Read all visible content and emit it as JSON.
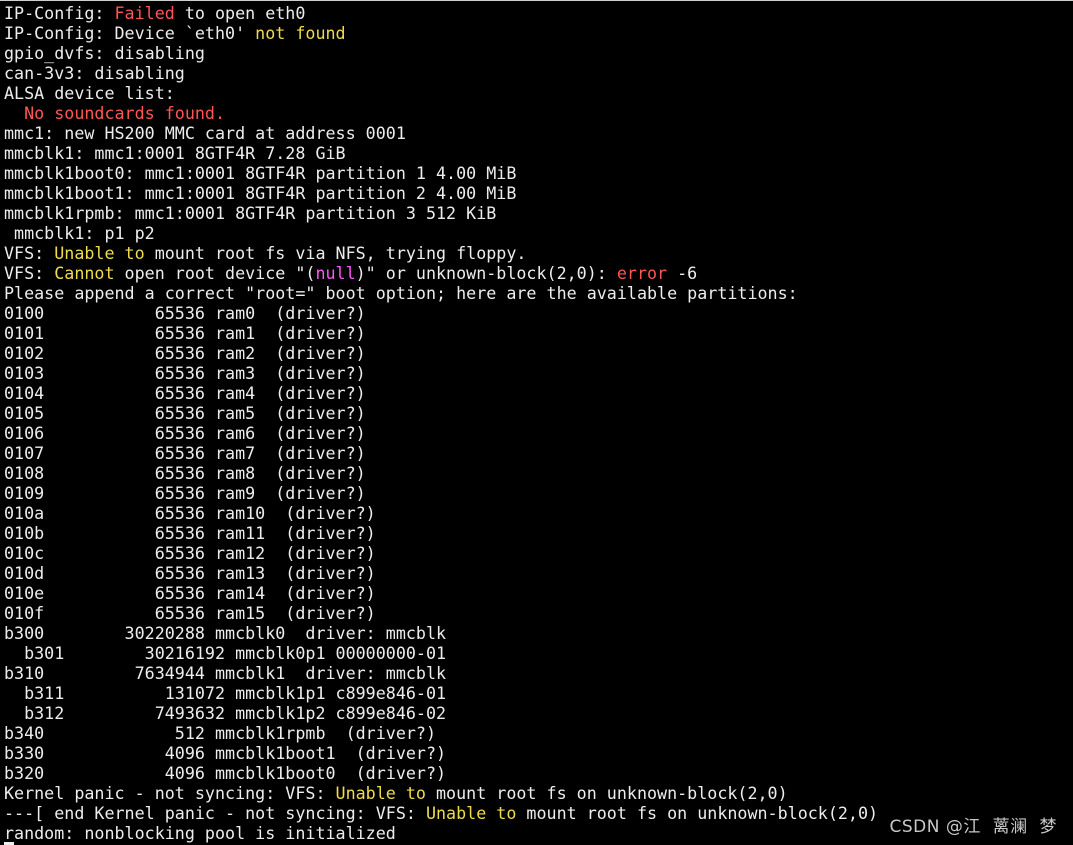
{
  "colors": {
    "background": "#000000",
    "text": "#ededed",
    "red": "#ff5555",
    "yellow": "#f0dc4a",
    "magenta": "#ff55ff"
  },
  "lines": [
    [
      {
        "t": "IP-Config: ",
        "c": "default"
      },
      {
        "t": "Failed",
        "c": "red"
      },
      {
        "t": " to open eth0",
        "c": "default"
      }
    ],
    [
      {
        "t": "IP-Config: Device `eth0' ",
        "c": "default"
      },
      {
        "t": "not found",
        "c": "yellow"
      }
    ],
    [
      {
        "t": "gpio_dvfs: disabling",
        "c": "default"
      }
    ],
    [
      {
        "t": "can-3v3: disabling",
        "c": "default"
      }
    ],
    [
      {
        "t": "ALSA device list:",
        "c": "default"
      }
    ],
    [
      {
        "t": "  No soundcards found.",
        "c": "red"
      }
    ],
    [
      {
        "t": "mmc1: new HS200 MMC card at address 0001",
        "c": "default"
      }
    ],
    [
      {
        "t": "mmcblk1: mmc1:0001 8GTF4R 7.28 GiB",
        "c": "default"
      }
    ],
    [
      {
        "t": "mmcblk1boot0: mmc1:0001 8GTF4R partition 1 4.00 MiB",
        "c": "default"
      }
    ],
    [
      {
        "t": "mmcblk1boot1: mmc1:0001 8GTF4R partition 2 4.00 MiB",
        "c": "default"
      }
    ],
    [
      {
        "t": "mmcblk1rpmb: mmc1:0001 8GTF4R partition 3 512 KiB",
        "c": "default"
      }
    ],
    [
      {
        "t": " mmcblk1: p1 p2",
        "c": "default"
      }
    ],
    [
      {
        "t": "VFS: ",
        "c": "default"
      },
      {
        "t": "Unable to",
        "c": "yellow"
      },
      {
        "t": " mount root fs via NFS, trying floppy.",
        "c": "default"
      }
    ],
    [
      {
        "t": "VFS: ",
        "c": "default"
      },
      {
        "t": "Cannot",
        "c": "yellow"
      },
      {
        "t": " open root device \"(",
        "c": "default"
      },
      {
        "t": "null",
        "c": "magenta"
      },
      {
        "t": ")\" or unknown-block(2,0): ",
        "c": "default"
      },
      {
        "t": "error",
        "c": "red"
      },
      {
        "t": " -6",
        "c": "default"
      }
    ],
    [
      {
        "t": "Please append a correct \"root=\" boot option; here are the available partitions:",
        "c": "default"
      }
    ],
    [
      {
        "t": "0100           65536 ram0  (driver?)",
        "c": "default"
      }
    ],
    [
      {
        "t": "0101           65536 ram1  (driver?)",
        "c": "default"
      }
    ],
    [
      {
        "t": "0102           65536 ram2  (driver?)",
        "c": "default"
      }
    ],
    [
      {
        "t": "0103           65536 ram3  (driver?)",
        "c": "default"
      }
    ],
    [
      {
        "t": "0104           65536 ram4  (driver?)",
        "c": "default"
      }
    ],
    [
      {
        "t": "0105           65536 ram5  (driver?)",
        "c": "default"
      }
    ],
    [
      {
        "t": "0106           65536 ram6  (driver?)",
        "c": "default"
      }
    ],
    [
      {
        "t": "0107           65536 ram7  (driver?)",
        "c": "default"
      }
    ],
    [
      {
        "t": "0108           65536 ram8  (driver?)",
        "c": "default"
      }
    ],
    [
      {
        "t": "0109           65536 ram9  (driver?)",
        "c": "default"
      }
    ],
    [
      {
        "t": "010a           65536 ram10  (driver?)",
        "c": "default"
      }
    ],
    [
      {
        "t": "010b           65536 ram11  (driver?)",
        "c": "default"
      }
    ],
    [
      {
        "t": "010c           65536 ram12  (driver?)",
        "c": "default"
      }
    ],
    [
      {
        "t": "010d           65536 ram13  (driver?)",
        "c": "default"
      }
    ],
    [
      {
        "t": "010e           65536 ram14  (driver?)",
        "c": "default"
      }
    ],
    [
      {
        "t": "010f           65536 ram15  (driver?)",
        "c": "default"
      }
    ],
    [
      {
        "t": "b300        30220288 mmcblk0  driver: mmcblk",
        "c": "default"
      }
    ],
    [
      {
        "t": "  b301        30216192 mmcblk0p1 00000000-01",
        "c": "default"
      }
    ],
    [
      {
        "t": "b310         7634944 mmcblk1  driver: mmcblk",
        "c": "default"
      }
    ],
    [
      {
        "t": "  b311          131072 mmcblk1p1 c899e846-01",
        "c": "default"
      }
    ],
    [
      {
        "t": "  b312         7493632 mmcblk1p2 c899e846-02",
        "c": "default"
      }
    ],
    [
      {
        "t": "b340             512 mmcblk1rpmb  (driver?)",
        "c": "default"
      }
    ],
    [
      {
        "t": "b330            4096 mmcblk1boot1  (driver?)",
        "c": "default"
      }
    ],
    [
      {
        "t": "b320            4096 mmcblk1boot0  (driver?)",
        "c": "default"
      }
    ],
    [
      {
        "t": "Kernel panic - not syncing: VFS: ",
        "c": "default"
      },
      {
        "t": "Unable to",
        "c": "yellow"
      },
      {
        "t": " mount root fs on unknown-block(2,0)",
        "c": "default"
      }
    ],
    [
      {
        "t": "---[ end Kernel panic - not syncing: VFS: ",
        "c": "default"
      },
      {
        "t": "Unable to",
        "c": "yellow"
      },
      {
        "t": " mount root fs on unknown-block(2,0)",
        "c": "default"
      }
    ],
    [
      {
        "t": "random: nonblocking pool is initialized",
        "c": "default"
      }
    ]
  ],
  "watermark": "CSDN @江  蓠澜  梦"
}
